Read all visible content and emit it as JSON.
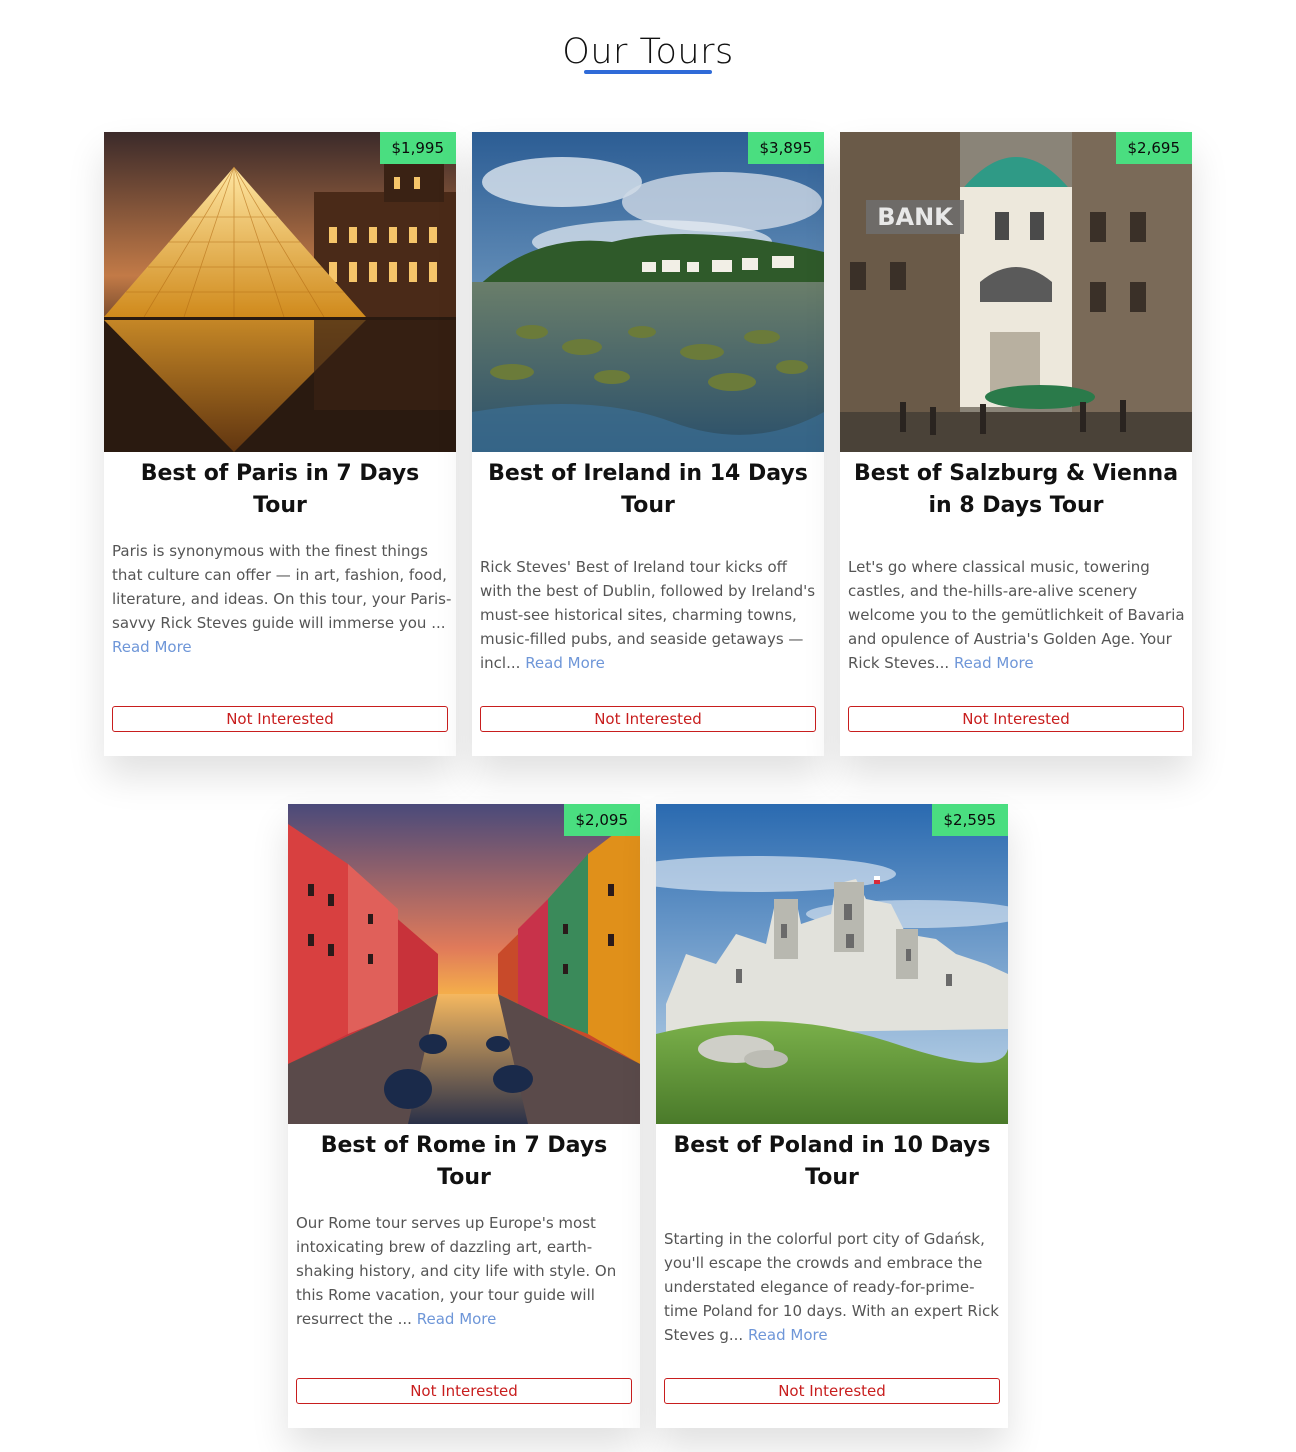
{
  "header": {
    "title": "Our Tours",
    "underline_color": "#2f6bd8"
  },
  "colors": {
    "price_badge": "#4ade80",
    "read_more": "#6e96d8",
    "not_interested": "#c81e1e"
  },
  "tours": [
    {
      "price": "$1,995",
      "title": "Best of Paris in 7 Days Tour",
      "description": "Paris is synonymous with the finest things that culture can offer — in art, fashion, food, literature, and ideas. On this tour, your Paris-savvy Rick Steves guide will immerse you ...",
      "read_more": "Read More",
      "button": "Not Interested",
      "image": "louvre-pyramid-photo"
    },
    {
      "price": "$3,895",
      "title": "Best of Ireland in 14 Days Tour",
      "description": "Rick Steves' Best of Ireland tour kicks off with the best of Dublin, followed by Ireland's must-see historical sites, charming towns, music-filled pubs, and seaside getaways — incl...",
      "read_more": "Read More",
      "button": "Not Interested",
      "image": "irish-coast-photo"
    },
    {
      "price": "$2,695",
      "title": "Best of Salzburg & Vienna in 8 Days Tour",
      "description": "Let's go where classical music, towering castles, and the-hills-are-alive scenery welcome you to the gemütlichkeit of Bavaria and opulence of Austria's Golden Age. Your Rick Steves...",
      "read_more": "Read More",
      "button": "Not Interested",
      "image": "vienna-street-photo",
      "image_text": "BANK"
    },
    {
      "price": "$2,095",
      "title": "Best of Rome in 7 Days Tour",
      "description": "Our Rome tour serves up Europe's most intoxicating brew of dazzling art, earth-shaking history, and city life with style. On this Rome vacation, your tour guide will resurrect the ...",
      "read_more": "Read More",
      "button": "Not Interested",
      "image": "canal-sunset-photo"
    },
    {
      "price": "$2,595",
      "title": "Best of Poland in 10 Days Tour",
      "description": "Starting in the colorful port city of Gdańsk, you'll escape the crowds and embrace the understated elegance of ready-for-prime-time Poland for 10 days. With an expert Rick Steves g...",
      "read_more": "Read More",
      "button": "Not Interested",
      "image": "castle-ruins-photo"
    }
  ]
}
